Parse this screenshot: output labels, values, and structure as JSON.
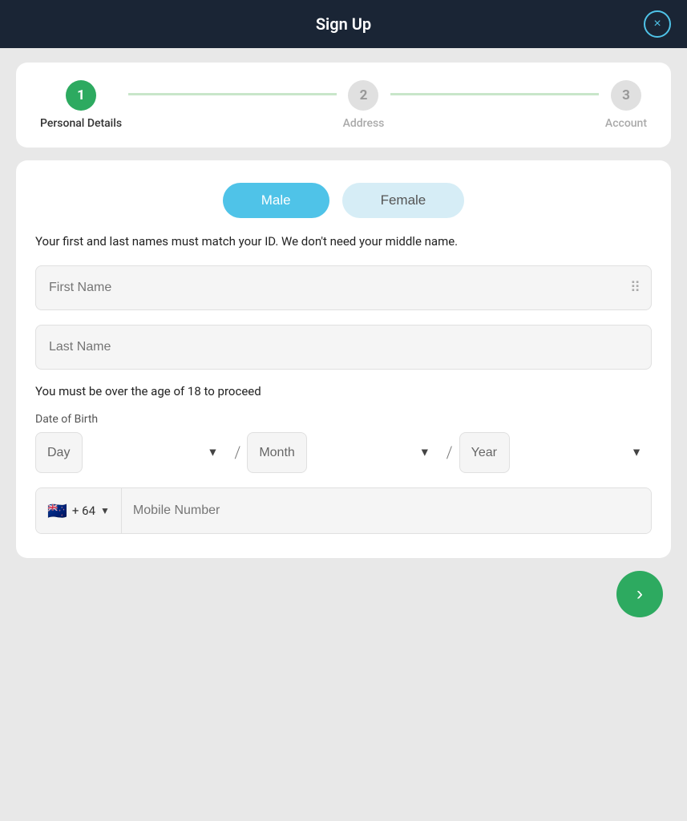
{
  "header": {
    "title": "Sign Up",
    "close_label": "×"
  },
  "steps": [
    {
      "number": "1",
      "label": "Personal Details",
      "state": "active"
    },
    {
      "number": "2",
      "label": "Address",
      "state": "inactive"
    },
    {
      "number": "3",
      "label": "Account",
      "state": "inactive"
    }
  ],
  "gender": {
    "male_label": "Male",
    "female_label": "Female"
  },
  "info_text": "Your first and last names must match your ID. We don't need your middle name.",
  "first_name_placeholder": "First Name",
  "last_name_placeholder": "Last Name",
  "age_text": "You must be over the age of 18 to proceed",
  "dob_label": "Date of Birth",
  "dob_day_placeholder": "Day",
  "dob_month_placeholder": "Month",
  "dob_year_placeholder": "Year",
  "phone_code": "+ 64",
  "phone_placeholder": "Mobile Number",
  "next_icon": "›"
}
